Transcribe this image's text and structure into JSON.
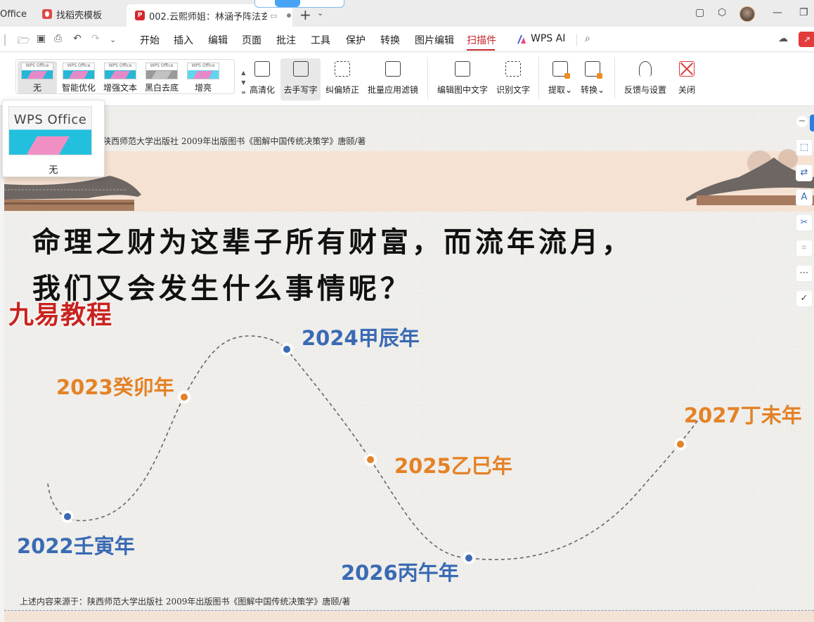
{
  "tabs": {
    "office_label": "Office",
    "template_label": "找稻壳模板",
    "doc_label": "002.云熙师姐：林涵予阵法玄",
    "add_symbol": "+",
    "more_symbol": "⌄"
  },
  "menu": {
    "items": [
      "开始",
      "插入",
      "编辑",
      "页面",
      "批注",
      "工具",
      "保护",
      "转换",
      "图片编辑",
      "扫描件",
      "WPS AI"
    ],
    "active": "扫描件"
  },
  "ribbon": {
    "filters": [
      {
        "label": "无",
        "thumb_text": "WPS Office"
      },
      {
        "label": "智能优化",
        "thumb_text": "WPS Office"
      },
      {
        "label": "增强文本",
        "thumb_text": "WPS Office"
      },
      {
        "label": "黑白去底",
        "thumb_text": "WPS Office"
      },
      {
        "label": "增亮",
        "thumb_text": "WPS Office"
      }
    ],
    "tools": [
      "高清化",
      "去手写字",
      "纠偏矫正",
      "批量应用滤镜",
      "编辑图中文字",
      "识别文字",
      "提取",
      "转换",
      "反馈与设置",
      "关闭"
    ]
  },
  "preview": {
    "thumb_text": "WPS Office",
    "label": "无"
  },
  "document": {
    "source_top": "陕西师范大学出版社 2009年出版图书《图解中国传统决策学》唐颐/著",
    "source_bottom": "上述内容来源于：陕西师范大学出版社 2009年出版图书《图解中国传统决策学》唐颐/著",
    "title_line1": "命理之财为这辈子所有财富，而流年流月，",
    "title_line2": "我们又会发生什么事情呢？",
    "watermark": "九易教程",
    "years": [
      "2022壬寅年",
      "2023癸卯年",
      "2024甲辰年",
      "2025乙巳年",
      "2026丙午年",
      "2027丁未年"
    ],
    "colors": {
      "blue": "#3a6ab3",
      "orange": "#e48226"
    }
  }
}
